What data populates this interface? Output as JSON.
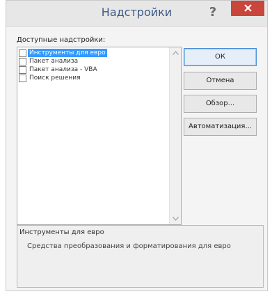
{
  "window": {
    "title": "Надстройки",
    "help_label": "?",
    "close_icon": "close-icon",
    "accent_close": "#c9463d",
    "title_color": "#3b5a86"
  },
  "addins": {
    "label": "Доступные надстройки:",
    "items": [
      {
        "label": "Инструменты для евро",
        "checked": false,
        "selected": true
      },
      {
        "label": "Пакет анализа",
        "checked": false,
        "selected": false
      },
      {
        "label": "Пакет анализа - VBA",
        "checked": false,
        "selected": false
      },
      {
        "label": "Поиск решения",
        "checked": false,
        "selected": false
      }
    ]
  },
  "buttons": {
    "ok": "ОК",
    "cancel": "Отмена",
    "browse": "Обзор...",
    "automation": "Автоматизация..."
  },
  "description": {
    "title": "Инструменты для евро",
    "text": "Средства преобразования и форматирования для евро"
  }
}
